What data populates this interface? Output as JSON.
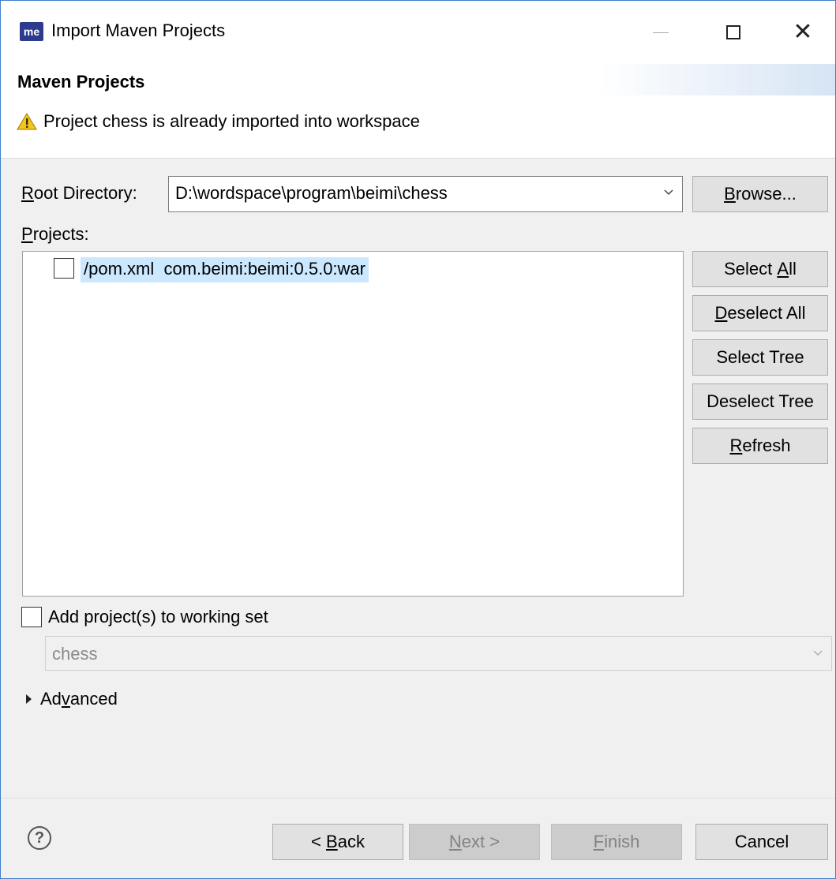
{
  "window": {
    "app_icon_text": "me",
    "title": "Import Maven Projects"
  },
  "banner": {
    "title": "Maven Projects",
    "message": "Project chess is already imported into workspace"
  },
  "root_directory": {
    "label_mnemonic": "R",
    "label_rest": "oot Directory:",
    "value": "D:\\wordspace\\program\\beimi\\chess",
    "browse_mnemonic": "B",
    "browse_rest": "rowse..."
  },
  "projects": {
    "label_mnemonic": "P",
    "label_rest": "rojects:",
    "items": [
      {
        "label": "/pom.xml  com.beimi:beimi:0.5.0:war",
        "checked": false
      }
    ]
  },
  "side_buttons": {
    "select_all_pre": "Select ",
    "select_all_mn": "A",
    "select_all_post": "ll",
    "deselect_all_mn": "D",
    "deselect_all_post": "eselect All",
    "select_tree": "Select Tree",
    "deselect_tree": "Deselect Tree",
    "refresh_mn": "R",
    "refresh_post": "efresh"
  },
  "working_set": {
    "label": "Add project(s) to working set",
    "checked": false,
    "value": "chess"
  },
  "advanced": {
    "pre": "Ad",
    "mn": "v",
    "post": "anced"
  },
  "footer": {
    "help_glyph": "?",
    "back_pre": "< ",
    "back_mn": "B",
    "back_post": "ack",
    "next_mn": "N",
    "next_post": "ext >",
    "finish_mn": "F",
    "finish_post": "inish",
    "cancel": "Cancel"
  },
  "colors": {
    "window_border": "#3f7fc9",
    "selection": "#cce8ff",
    "button": "#e1e1e1",
    "disabled_text": "#838383"
  }
}
